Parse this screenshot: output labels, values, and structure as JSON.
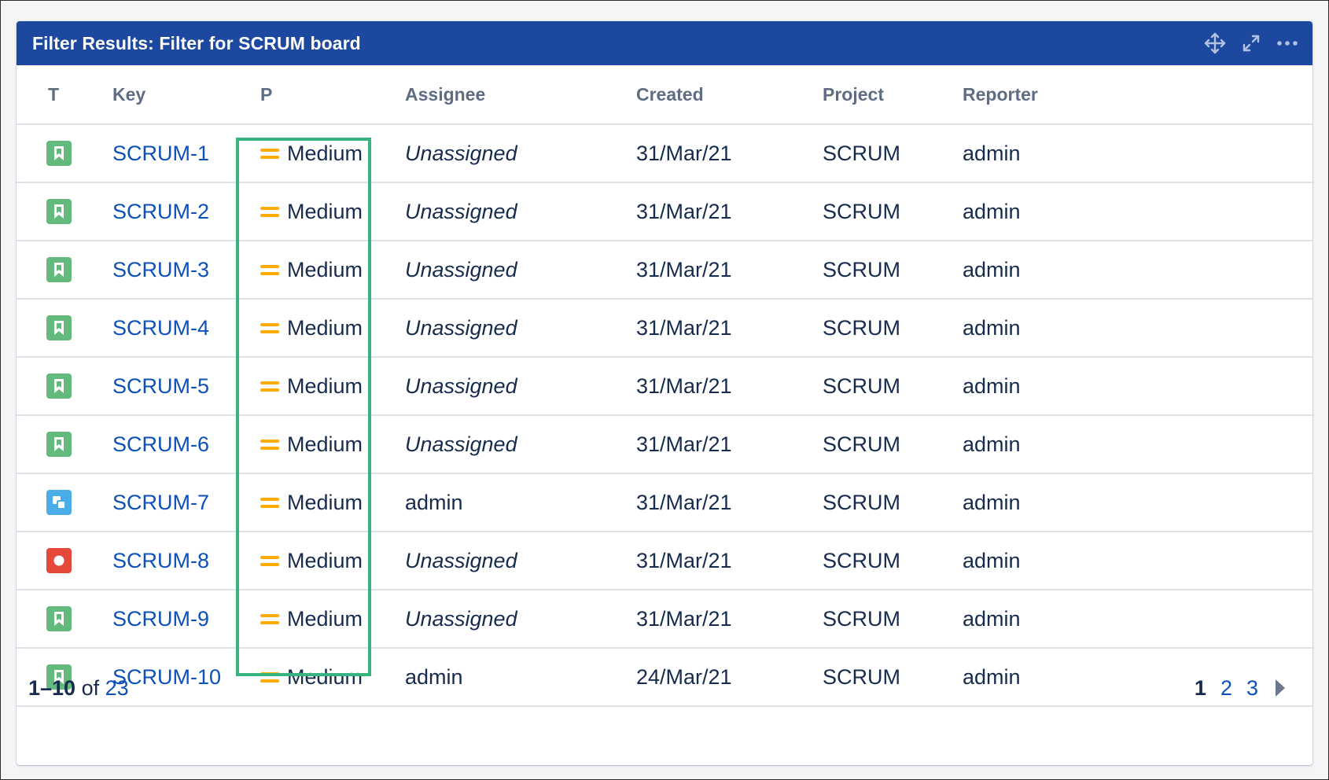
{
  "gadget": {
    "title": "Filter Results: Filter for SCRUM board"
  },
  "header_actions": [
    {
      "icon": "move-icon"
    },
    {
      "icon": "expand-icon"
    },
    {
      "icon": "more-icon"
    }
  ],
  "columns": {
    "type": "T",
    "key": "Key",
    "priority": "P",
    "assignee": "Assignee",
    "created": "Created",
    "project": "Project",
    "reporter": "Reporter"
  },
  "rows": [
    {
      "type": "story",
      "key": "SCRUM-1",
      "priority": "Medium",
      "assignee": "Unassigned",
      "created": "31/Mar/21",
      "project": "SCRUM",
      "reporter": "admin"
    },
    {
      "type": "story",
      "key": "SCRUM-2",
      "priority": "Medium",
      "assignee": "Unassigned",
      "created": "31/Mar/21",
      "project": "SCRUM",
      "reporter": "admin"
    },
    {
      "type": "story",
      "key": "SCRUM-3",
      "priority": "Medium",
      "assignee": "Unassigned",
      "created": "31/Mar/21",
      "project": "SCRUM",
      "reporter": "admin"
    },
    {
      "type": "story",
      "key": "SCRUM-4",
      "priority": "Medium",
      "assignee": "Unassigned",
      "created": "31/Mar/21",
      "project": "SCRUM",
      "reporter": "admin"
    },
    {
      "type": "story",
      "key": "SCRUM-5",
      "priority": "Medium",
      "assignee": "Unassigned",
      "created": "31/Mar/21",
      "project": "SCRUM",
      "reporter": "admin"
    },
    {
      "type": "story",
      "key": "SCRUM-6",
      "priority": "Medium",
      "assignee": "Unassigned",
      "created": "31/Mar/21",
      "project": "SCRUM",
      "reporter": "admin"
    },
    {
      "type": "subtask",
      "key": "SCRUM-7",
      "priority": "Medium",
      "assignee": "admin",
      "created": "31/Mar/21",
      "project": "SCRUM",
      "reporter": "admin"
    },
    {
      "type": "bug",
      "key": "SCRUM-8",
      "priority": "Medium",
      "assignee": "Unassigned",
      "created": "31/Mar/21",
      "project": "SCRUM",
      "reporter": "admin"
    },
    {
      "type": "story",
      "key": "SCRUM-9",
      "priority": "Medium",
      "assignee": "Unassigned",
      "created": "31/Mar/21",
      "project": "SCRUM",
      "reporter": "admin"
    },
    {
      "type": "story",
      "key": "SCRUM-10",
      "priority": "Medium",
      "assignee": "admin",
      "created": "24/Mar/21",
      "project": "SCRUM",
      "reporter": "admin"
    }
  ],
  "footer": {
    "range": "1–10",
    "of": "of",
    "total": "23"
  },
  "pagination": {
    "pages": [
      "1",
      "2",
      "3"
    ],
    "current": "1"
  },
  "colors": {
    "header_bg": "#1c48a0",
    "link": "#0c51b9",
    "priority_medium": "#ffab00",
    "story": "#63ba7c",
    "subtask": "#4bade8",
    "bug": "#e5493a",
    "highlight": "#36b37e"
  }
}
